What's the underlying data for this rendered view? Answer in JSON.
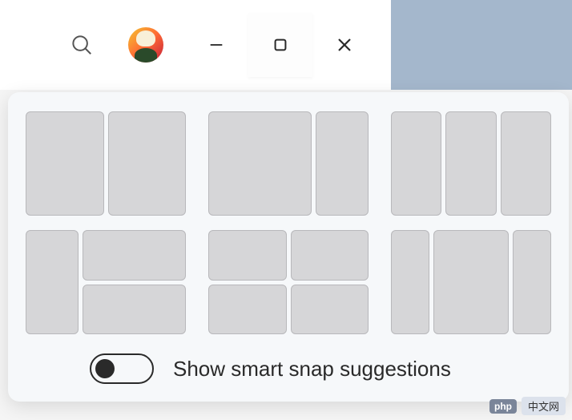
{
  "titlebar": {
    "search_icon": "search",
    "minimize_icon": "minimize",
    "maximize_icon": "maximize",
    "close_icon": "close"
  },
  "snap": {
    "toggle_on": false,
    "toggle_label": "Show smart snap suggestions",
    "layouts": [
      {
        "id": "two-halves"
      },
      {
        "id": "two-thirds-one-third"
      },
      {
        "id": "three-thirds"
      },
      {
        "id": "one-third-two-stacked"
      },
      {
        "id": "four-quadrants"
      },
      {
        "id": "narrow-wide-narrow"
      }
    ]
  },
  "watermark": {
    "badge": "php",
    "text": "中文网"
  }
}
